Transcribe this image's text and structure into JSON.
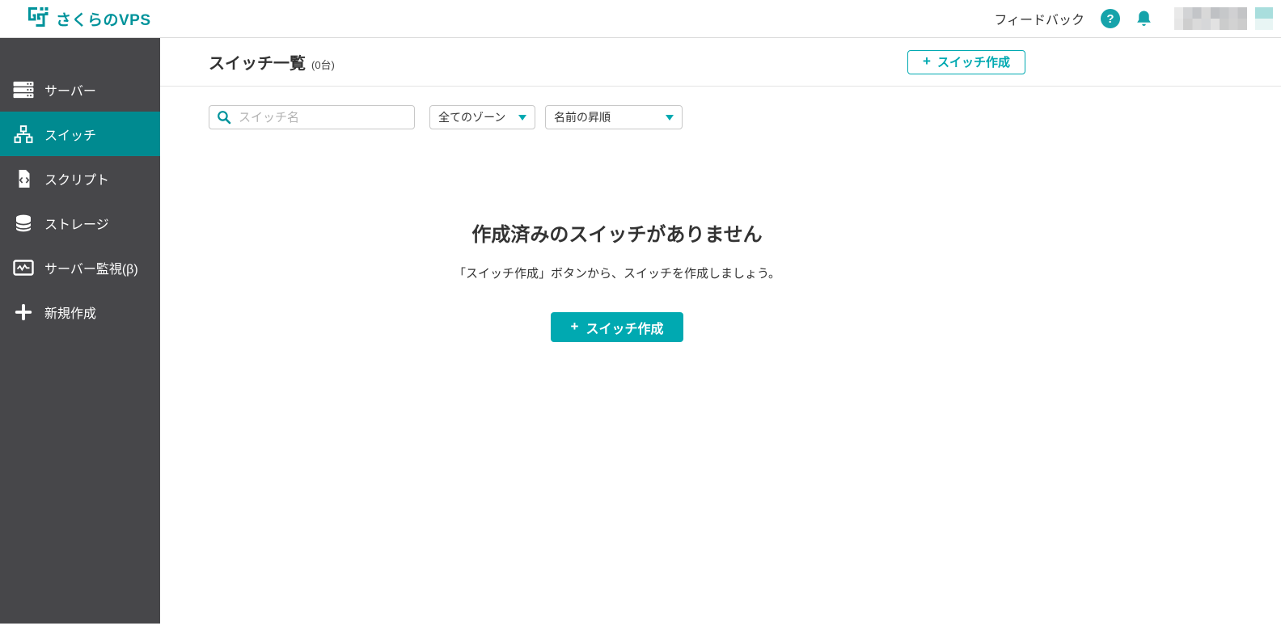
{
  "brand": {
    "logo_text": "さくらのVPS"
  },
  "header": {
    "feedback_label": "フィードバック",
    "help_glyph": "?"
  },
  "sidebar": {
    "items": [
      {
        "label": "サーバー",
        "icon": "server-icon",
        "active": false
      },
      {
        "label": "スイッチ",
        "icon": "switch-icon",
        "active": true
      },
      {
        "label": "スクリプト",
        "icon": "script-icon",
        "active": false
      },
      {
        "label": "ストレージ",
        "icon": "storage-icon",
        "active": false
      },
      {
        "label": "サーバー監視(β)",
        "icon": "monitor-icon",
        "active": false
      },
      {
        "label": "新規作成",
        "icon": "plus-icon",
        "active": false
      }
    ]
  },
  "page": {
    "title": "スイッチ一覧",
    "count": 0,
    "count_label": "(0台)",
    "plus_glyph": "+",
    "create_button_label": "スイッチ作成"
  },
  "filters": {
    "search_placeholder": "スイッチ名",
    "zone_value": "全てのゾーン",
    "sort_value": "名前の昇順"
  },
  "empty_state": {
    "title": "作成済みのスイッチがありません",
    "description": "「スイッチ作成」ボタンから、スイッチを作成しましょう。",
    "button_label": "スイッチ作成"
  },
  "colors": {
    "accent_teal": "#00a9b1",
    "logo_teal": "#00939b",
    "sidebar_bg": "#47474a",
    "sidebar_active_bg": "#008a90",
    "icon_badge_teal": "#16a3aa",
    "text_dark": "#333333",
    "divider": "#e3e3e3",
    "input_border": "#c8c8c8",
    "placeholder": "#b3b3b3"
  }
}
